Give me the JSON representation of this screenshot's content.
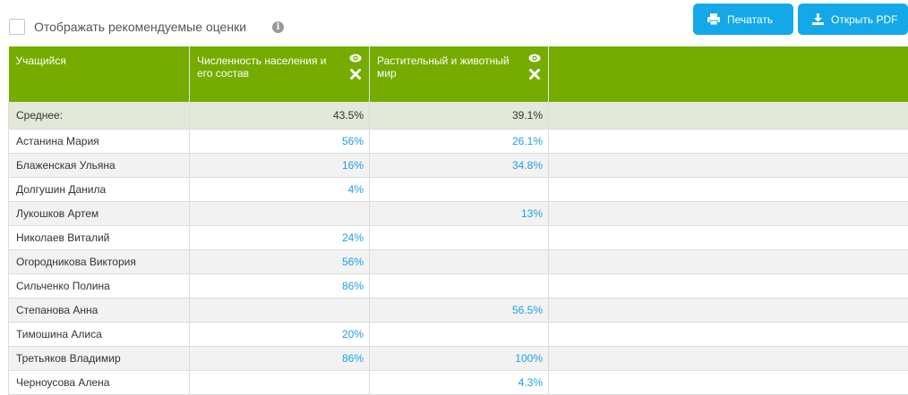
{
  "options": {
    "recommended_label": "Отображать рекомендуемые оценки",
    "info_glyph": "i"
  },
  "buttons": {
    "print": "Печатать",
    "pdf": "Открыть PDF"
  },
  "colors": {
    "header_green": "#76ab00",
    "button_blue": "#14a8e8",
    "value_blue": "#1fa0e3"
  },
  "table": {
    "columns": [
      "Учащийся",
      "Численность населения и его состав",
      "Растительный и животный мир",
      ""
    ],
    "average": {
      "label": "Среднее:",
      "c1": "43.5%",
      "c2": "39.1%"
    },
    "rows": [
      {
        "name": "Астанина Мария",
        "c1": "56%",
        "c2": "26.1%"
      },
      {
        "name": "Блаженская Ульяна",
        "c1": "16%",
        "c2": "34.8%"
      },
      {
        "name": "Долгушин Данила",
        "c1": "4%",
        "c2": ""
      },
      {
        "name": "Лукошков Артем",
        "c1": "",
        "c2": "13%"
      },
      {
        "name": "Николаев Виталий",
        "c1": "24%",
        "c2": ""
      },
      {
        "name": "Огородникова Виктория",
        "c1": "56%",
        "c2": ""
      },
      {
        "name": "Сильченко Полина",
        "c1": "86%",
        "c2": ""
      },
      {
        "name": "Степанова Анна",
        "c1": "",
        "c2": "56.5%"
      },
      {
        "name": "Тимошина Алиса",
        "c1": "20%",
        "c2": ""
      },
      {
        "name": "Третьяков Владимир",
        "c1": "86%",
        "c2": "100%"
      },
      {
        "name": "Черноусова Алена",
        "c1": "",
        "c2": "4.3%"
      }
    ]
  }
}
